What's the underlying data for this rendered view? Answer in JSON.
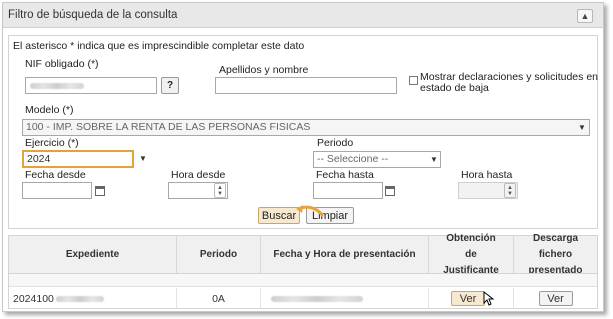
{
  "panel": {
    "title": "Filtro de búsqueda de la consulta",
    "collapse_icon": "chevron-up-icon"
  },
  "form": {
    "notice": "El asterisco * indica que es imprescindible completar este dato",
    "nif_label": "NIF obligado (*)",
    "nif_help": "?",
    "apellidos_label": "Apellidos y nombre",
    "apellidos_value": "",
    "baja_label_line1": "Mostrar declaraciones y solicitudes en",
    "baja_label_line2": "estado de baja",
    "baja_checked": false,
    "modelo_label": "Modelo (*)",
    "modelo_value": "100 - IMP. SOBRE LA RENTA DE LAS PERSONAS FISICAS",
    "ejercicio_label": "Ejercicio (*)",
    "ejercicio_value": "2024",
    "periodo_label": "Periodo",
    "periodo_value": "-- Seleccione --",
    "fecha_desde_label": "Fecha desde",
    "hora_desde_label": "Hora desde",
    "fecha_hasta_label": "Fecha hasta",
    "hora_hasta_label": "Hora hasta",
    "buscar_label": "Buscar",
    "limpiar_label": "Limpiar"
  },
  "results": {
    "columns": [
      "Expediente",
      "Periodo",
      "Fecha y Hora de presentación",
      "Obtención de Justificante",
      "Descarga fichero presentado"
    ],
    "rows": [
      {
        "expediente": "2024100",
        "periodo": "0A",
        "justificante_button": "Ver",
        "descarga_button": "Ver"
      }
    ]
  },
  "colors": {
    "header_bg": "#e8e8e8",
    "highlight_border": "#e6a23a",
    "pointer_arrow": "#e8a33d",
    "hover_button": "#f6e9cf"
  }
}
